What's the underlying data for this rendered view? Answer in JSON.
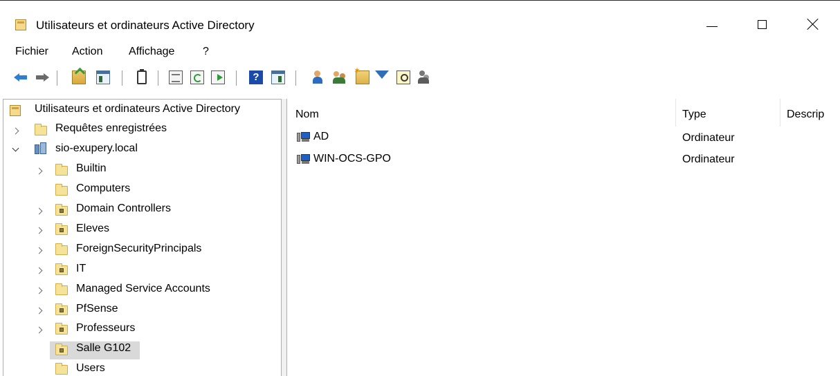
{
  "window": {
    "title": "Utilisateurs et ordinateurs Active Directory",
    "icon": "active-directory-icon",
    "controls": [
      "minimize",
      "maximize",
      "close"
    ]
  },
  "menu": {
    "items": [
      "Fichier",
      "Action",
      "Affichage",
      "?"
    ]
  },
  "toolbar": {
    "buttons": [
      "back-icon",
      "forward-icon",
      "up-level-icon",
      "show-hide-console-tree-icon",
      "clipboard-icon",
      "properties-icon",
      "refresh-icon",
      "export-list-icon",
      "help-icon",
      "columns-icon",
      "new-user-icon",
      "new-group-icon",
      "new-ou-icon",
      "filter-icon",
      "find-icon",
      "delegate-control-icon"
    ]
  },
  "tree": {
    "root": "Utilisateurs et ordinateurs Active Directory",
    "saved_queries": "Requêtes enregistrées",
    "domain": "sio-exupery.local",
    "children": [
      {
        "label": "Builtin",
        "type": "container",
        "expandable": true
      },
      {
        "label": "Computers",
        "type": "container",
        "expandable": false
      },
      {
        "label": "Domain Controllers",
        "type": "ou",
        "expandable": true
      },
      {
        "label": "Eleves",
        "type": "ou",
        "expandable": true
      },
      {
        "label": "ForeignSecurityPrincipals",
        "type": "container",
        "expandable": true
      },
      {
        "label": "IT",
        "type": "ou",
        "expandable": true
      },
      {
        "label": "Managed Service Accounts",
        "type": "container",
        "expandable": true
      },
      {
        "label": "PfSense",
        "type": "ou",
        "expandable": true
      },
      {
        "label": "Professeurs",
        "type": "ou",
        "expandable": true
      },
      {
        "label": "Salle G102",
        "type": "ou",
        "expandable": false,
        "selected": true
      },
      {
        "label": "Users",
        "type": "container",
        "expandable": false
      }
    ]
  },
  "list": {
    "columns": [
      "Nom",
      "Type",
      "Descrip"
    ],
    "rows": [
      {
        "name": "AD",
        "type": "Ordinateur",
        "icon": "computer-icon"
      },
      {
        "name": "WIN-OCS-GPO",
        "type": "Ordinateur",
        "icon": "computer-icon"
      }
    ]
  },
  "colors": {
    "selection": "#d9d9d9",
    "border": "#adadad",
    "folder": "#f6e39a"
  }
}
